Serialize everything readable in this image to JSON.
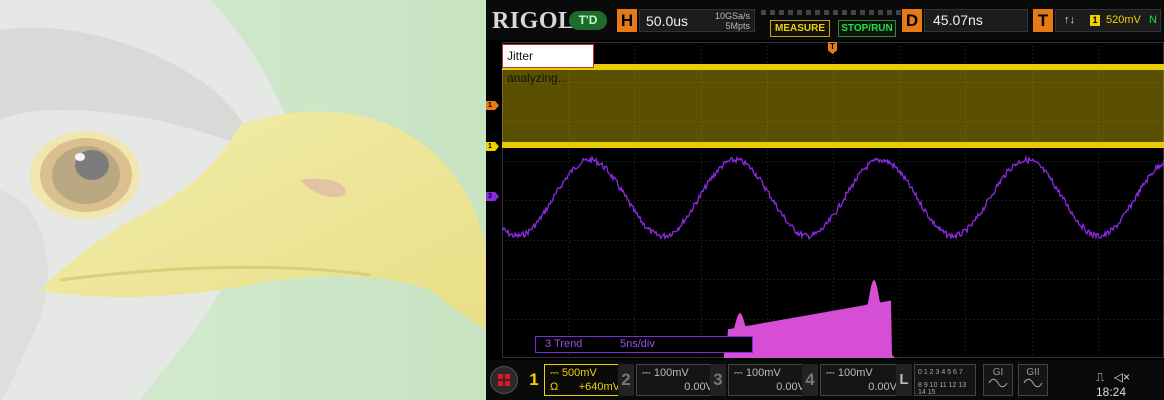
{
  "header": {
    "brand": "RIGOL",
    "trigger_status": "T'D",
    "horizontal": {
      "label": "H",
      "timebase": "50.0us",
      "sample_rate": "10GSa/s",
      "memory_depth": "5Mpts"
    },
    "measure_label": "MEASURE",
    "stoprun_label": "STOP/RUN",
    "delay": {
      "label": "D",
      "value": "45.07ns"
    },
    "trigger": {
      "label": "T",
      "edge_symbol": "↑↓",
      "channel": "1",
      "level": "520mV",
      "mode": "N"
    }
  },
  "screen": {
    "marker_orange": "1",
    "marker_yellow": "1",
    "marker_purple": "3",
    "trigger_marker": "T",
    "jitter_text": "Jitter analyzing...",
    "trend_label": "3 Trend",
    "trend_scale": "5ns/div"
  },
  "channels": [
    {
      "num": "1",
      "scale": "500mV",
      "coupling": "Ω",
      "offset": "+640mV"
    },
    {
      "num": "2",
      "scale": "100mV",
      "offset": "0.00V"
    },
    {
      "num": "3",
      "scale": "100mV",
      "offset": "0.00V"
    },
    {
      "num": "4",
      "scale": "100mV",
      "offset": "0.00V"
    }
  ],
  "logic": {
    "label": "L",
    "row1": "0 1 2 3  4 5 6 7",
    "row2": "8 9 10 11 12 13 14 15"
  },
  "bus": {
    "g1": "GI",
    "g2": "GII"
  },
  "status": {
    "time": "18:24"
  },
  "colors": {
    "ch1": "#f0d200",
    "ch3": "#8a2be2",
    "histogram": "#d64ed6",
    "accent": "#e67a14",
    "run": "#19e63a"
  }
}
